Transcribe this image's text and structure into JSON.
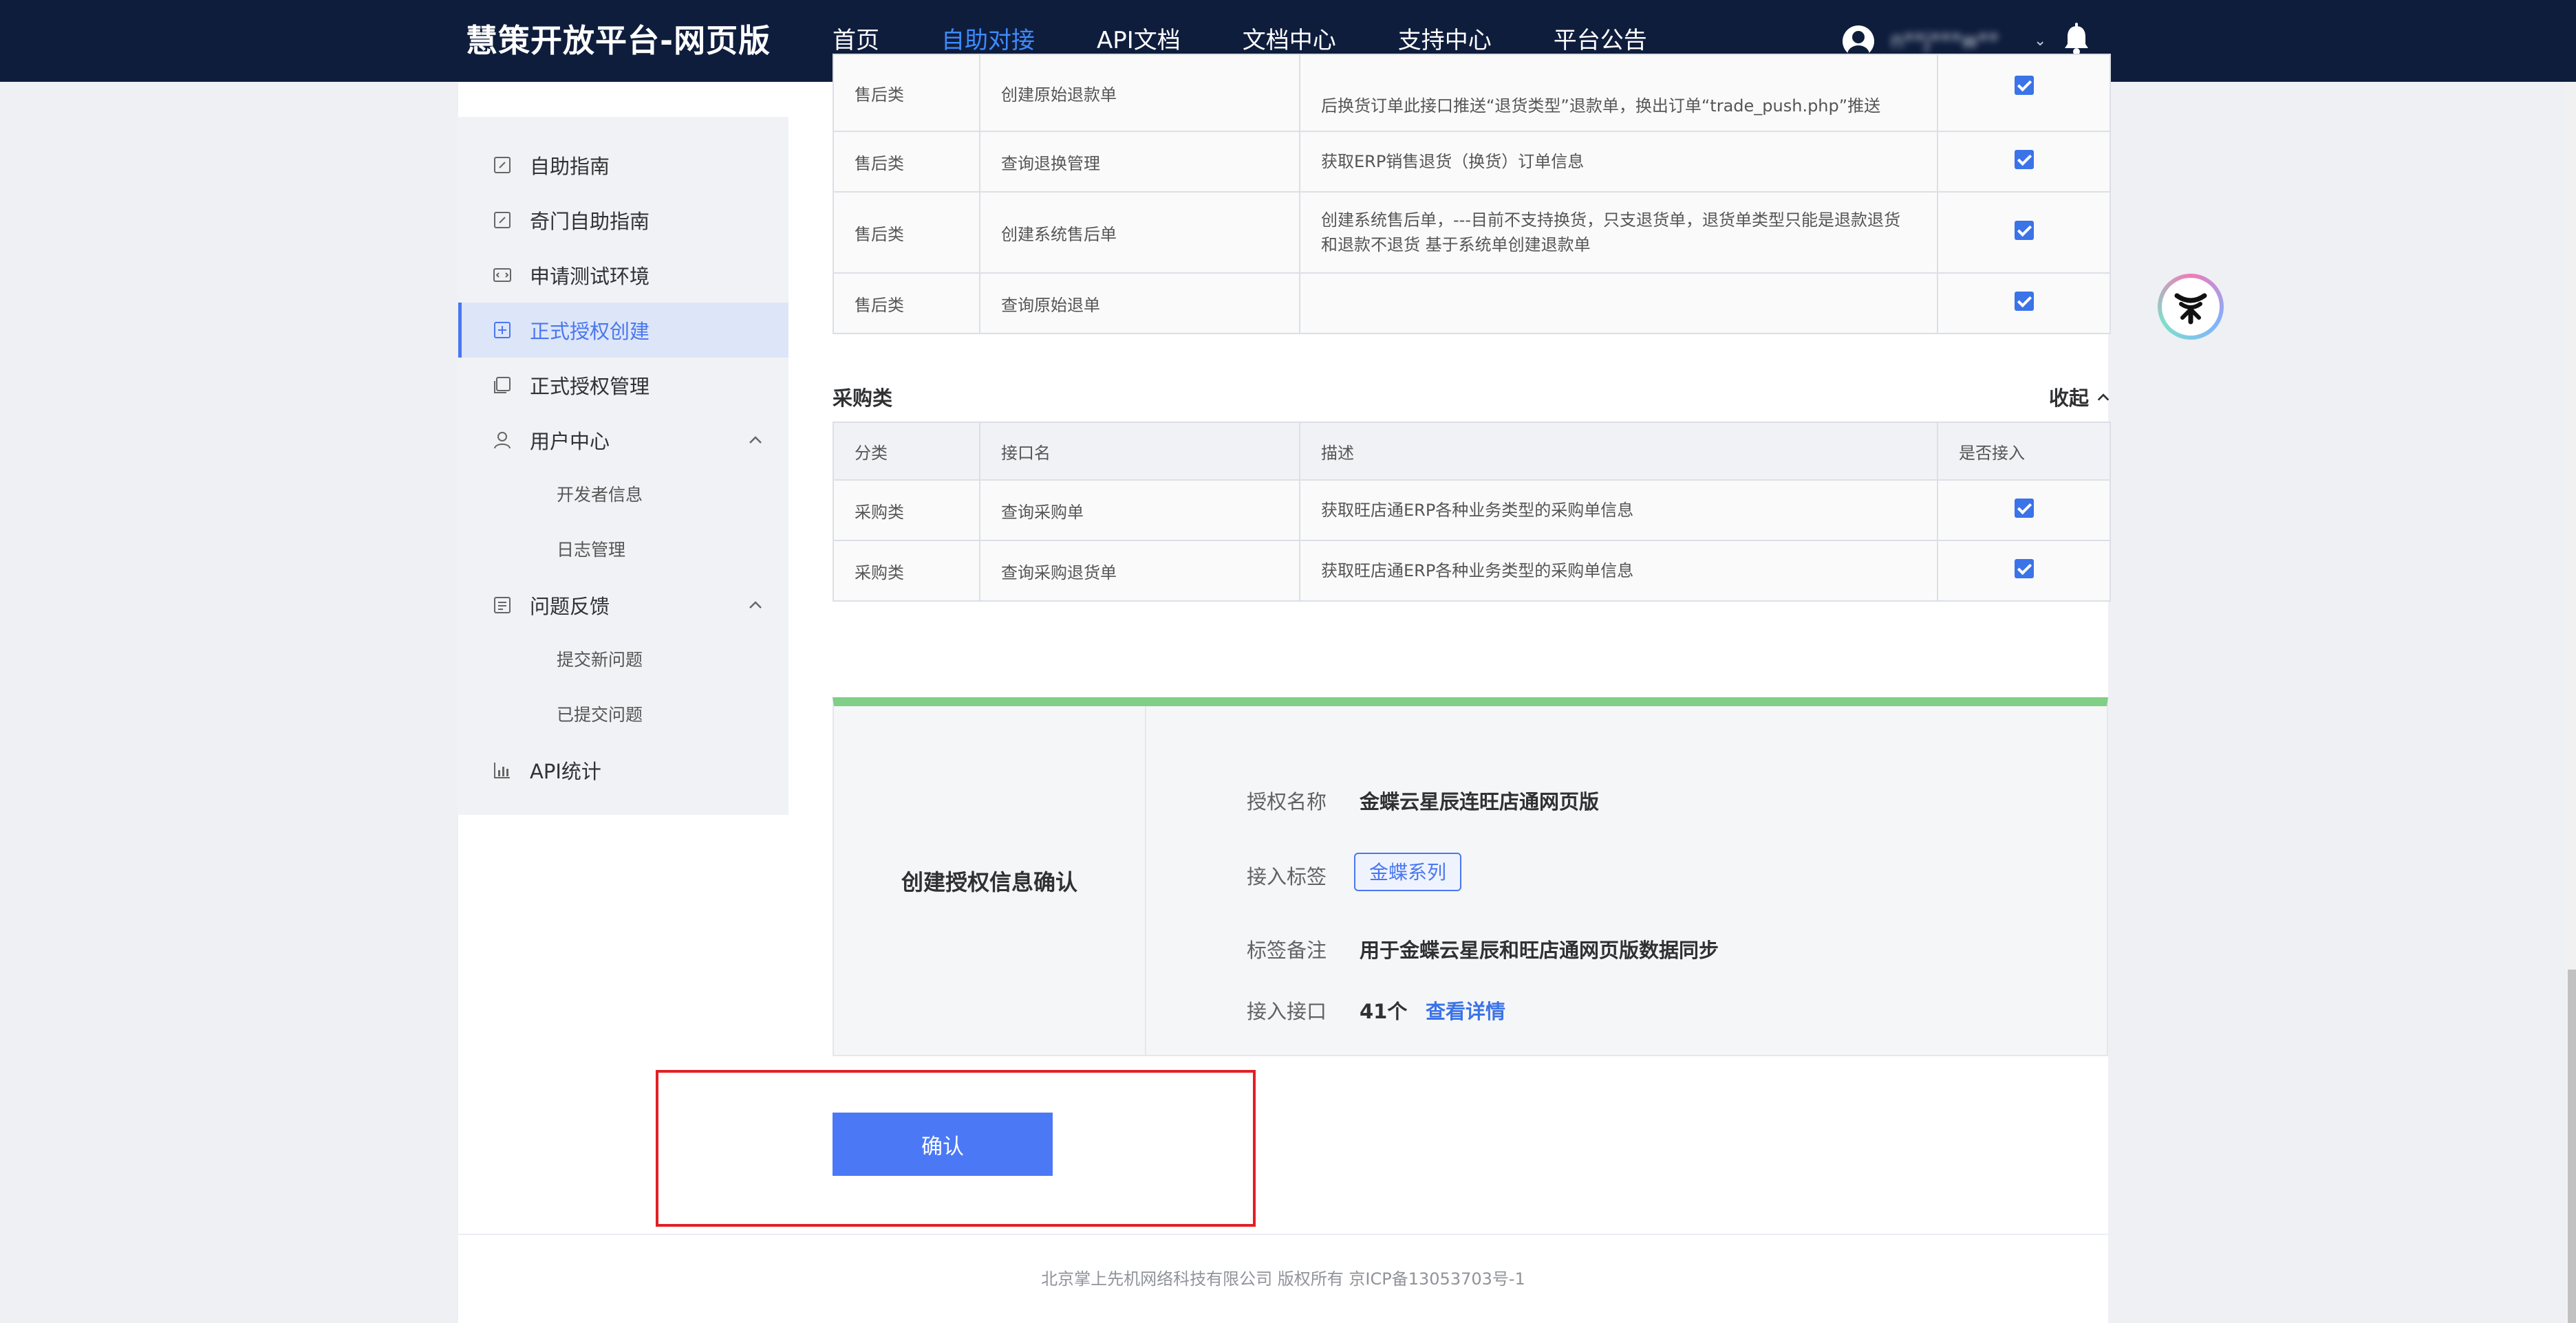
{
  "header": {
    "brand": "慧策开放平台-网页版",
    "nav": [
      {
        "label": "首页",
        "active": false
      },
      {
        "label": "自助对接",
        "active": true
      },
      {
        "label": "API文档",
        "active": false
      },
      {
        "label": "文档中心",
        "active": false
      },
      {
        "label": "支持中心",
        "active": false
      },
      {
        "label": "平台公告",
        "active": false
      }
    ],
    "username": "n**j***w**"
  },
  "sidebar": {
    "items": [
      {
        "label": "自助指南"
      },
      {
        "label": "奇门自助指南"
      },
      {
        "label": "申请测试环境"
      },
      {
        "label": "正式授权创建",
        "active": true
      },
      {
        "label": "正式授权管理"
      },
      {
        "label": "用户中心",
        "sub": [
          "开发者信息",
          "日志管理"
        ]
      },
      {
        "label": "问题反馈",
        "sub": [
          "提交新问题",
          "已提交问题"
        ]
      },
      {
        "label": "API统计"
      }
    ]
  },
  "aftersale_table": {
    "rows": [
      {
        "category": "售后类",
        "name": "创建原始退款单",
        "desc": "后换货订单此接口推送“退货类型”退款单，换出订单“trade_push.php”推送",
        "checked": true
      },
      {
        "category": "售后类",
        "name": "查询退换管理",
        "desc": "获取ERP销售退货（换货）订单信息",
        "checked": true
      },
      {
        "category": "售后类",
        "name": "创建系统售后单",
        "desc": "创建系统售后单，---目前不支持换货，只支退货单，退货单类型只能是退款退货和退款不退货 基于系统单创建退款单",
        "checked": true
      },
      {
        "category": "售后类",
        "name": "查询原始退单",
        "desc": "",
        "checked": true
      }
    ]
  },
  "purchase_section": {
    "title": "采购类",
    "collapse_label": "收起",
    "headers": [
      "分类",
      "接口名",
      "描述",
      "是否接入"
    ],
    "rows": [
      {
        "category": "采购类",
        "name": "查询采购单",
        "desc": "获取旺店通ERP各种业务类型的采购单信息",
        "checked": true
      },
      {
        "category": "采购类",
        "name": "查询采购退货单",
        "desc": "获取旺店通ERP各种业务类型的采购单信息",
        "checked": true
      }
    ]
  },
  "confirm": {
    "title": "创建授权信息确认",
    "auth_name_label": "授权名称",
    "auth_name_value": "金蝶云星辰连旺店通网页版",
    "tag_label": "接入标签",
    "tag_value": "金蝶系列",
    "remark_label": "标签备注",
    "remark_value": "用于金蝶云星辰和旺店通网页版数据同步",
    "api_label": "接入接口",
    "api_count": "41个",
    "detail_link": "查看详情"
  },
  "confirm_button": "确认",
  "footer": "北京掌上先机网络科技有限公司 版权所有 京ICP备13053703号-1",
  "colors": {
    "header_bg": "#0f1d3d",
    "accent": "#4b78f5",
    "success_bar": "#7fcf86",
    "highlight_box": "#e12025"
  }
}
